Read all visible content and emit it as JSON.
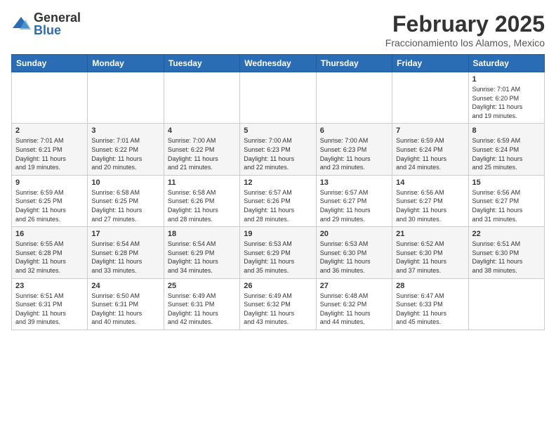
{
  "header": {
    "logo_general": "General",
    "logo_blue": "Blue",
    "month_year": "February 2025",
    "location": "Fraccionamiento los Alamos, Mexico"
  },
  "weekdays": [
    "Sunday",
    "Monday",
    "Tuesday",
    "Wednesday",
    "Thursday",
    "Friday",
    "Saturday"
  ],
  "weeks": [
    [
      {
        "day": "",
        "info": ""
      },
      {
        "day": "",
        "info": ""
      },
      {
        "day": "",
        "info": ""
      },
      {
        "day": "",
        "info": ""
      },
      {
        "day": "",
        "info": ""
      },
      {
        "day": "",
        "info": ""
      },
      {
        "day": "1",
        "info": "Sunrise: 7:01 AM\nSunset: 6:20 PM\nDaylight: 11 hours\nand 19 minutes."
      }
    ],
    [
      {
        "day": "2",
        "info": "Sunrise: 7:01 AM\nSunset: 6:21 PM\nDaylight: 11 hours\nand 19 minutes."
      },
      {
        "day": "3",
        "info": "Sunrise: 7:01 AM\nSunset: 6:22 PM\nDaylight: 11 hours\nand 20 minutes."
      },
      {
        "day": "4",
        "info": "Sunrise: 7:00 AM\nSunset: 6:22 PM\nDaylight: 11 hours\nand 21 minutes."
      },
      {
        "day": "5",
        "info": "Sunrise: 7:00 AM\nSunset: 6:23 PM\nDaylight: 11 hours\nand 22 minutes."
      },
      {
        "day": "6",
        "info": "Sunrise: 7:00 AM\nSunset: 6:23 PM\nDaylight: 11 hours\nand 23 minutes."
      },
      {
        "day": "7",
        "info": "Sunrise: 6:59 AM\nSunset: 6:24 PM\nDaylight: 11 hours\nand 24 minutes."
      },
      {
        "day": "8",
        "info": "Sunrise: 6:59 AM\nSunset: 6:24 PM\nDaylight: 11 hours\nand 25 minutes."
      }
    ],
    [
      {
        "day": "9",
        "info": "Sunrise: 6:59 AM\nSunset: 6:25 PM\nDaylight: 11 hours\nand 26 minutes."
      },
      {
        "day": "10",
        "info": "Sunrise: 6:58 AM\nSunset: 6:25 PM\nDaylight: 11 hours\nand 27 minutes."
      },
      {
        "day": "11",
        "info": "Sunrise: 6:58 AM\nSunset: 6:26 PM\nDaylight: 11 hours\nand 28 minutes."
      },
      {
        "day": "12",
        "info": "Sunrise: 6:57 AM\nSunset: 6:26 PM\nDaylight: 11 hours\nand 28 minutes."
      },
      {
        "day": "13",
        "info": "Sunrise: 6:57 AM\nSunset: 6:27 PM\nDaylight: 11 hours\nand 29 minutes."
      },
      {
        "day": "14",
        "info": "Sunrise: 6:56 AM\nSunset: 6:27 PM\nDaylight: 11 hours\nand 30 minutes."
      },
      {
        "day": "15",
        "info": "Sunrise: 6:56 AM\nSunset: 6:27 PM\nDaylight: 11 hours\nand 31 minutes."
      }
    ],
    [
      {
        "day": "16",
        "info": "Sunrise: 6:55 AM\nSunset: 6:28 PM\nDaylight: 11 hours\nand 32 minutes."
      },
      {
        "day": "17",
        "info": "Sunrise: 6:54 AM\nSunset: 6:28 PM\nDaylight: 11 hours\nand 33 minutes."
      },
      {
        "day": "18",
        "info": "Sunrise: 6:54 AM\nSunset: 6:29 PM\nDaylight: 11 hours\nand 34 minutes."
      },
      {
        "day": "19",
        "info": "Sunrise: 6:53 AM\nSunset: 6:29 PM\nDaylight: 11 hours\nand 35 minutes."
      },
      {
        "day": "20",
        "info": "Sunrise: 6:53 AM\nSunset: 6:30 PM\nDaylight: 11 hours\nand 36 minutes."
      },
      {
        "day": "21",
        "info": "Sunrise: 6:52 AM\nSunset: 6:30 PM\nDaylight: 11 hours\nand 37 minutes."
      },
      {
        "day": "22",
        "info": "Sunrise: 6:51 AM\nSunset: 6:30 PM\nDaylight: 11 hours\nand 38 minutes."
      }
    ],
    [
      {
        "day": "23",
        "info": "Sunrise: 6:51 AM\nSunset: 6:31 PM\nDaylight: 11 hours\nand 39 minutes."
      },
      {
        "day": "24",
        "info": "Sunrise: 6:50 AM\nSunset: 6:31 PM\nDaylight: 11 hours\nand 40 minutes."
      },
      {
        "day": "25",
        "info": "Sunrise: 6:49 AM\nSunset: 6:31 PM\nDaylight: 11 hours\nand 42 minutes."
      },
      {
        "day": "26",
        "info": "Sunrise: 6:49 AM\nSunset: 6:32 PM\nDaylight: 11 hours\nand 43 minutes."
      },
      {
        "day": "27",
        "info": "Sunrise: 6:48 AM\nSunset: 6:32 PM\nDaylight: 11 hours\nand 44 minutes."
      },
      {
        "day": "28",
        "info": "Sunrise: 6:47 AM\nSunset: 6:33 PM\nDaylight: 11 hours\nand 45 minutes."
      },
      {
        "day": "",
        "info": ""
      }
    ]
  ]
}
